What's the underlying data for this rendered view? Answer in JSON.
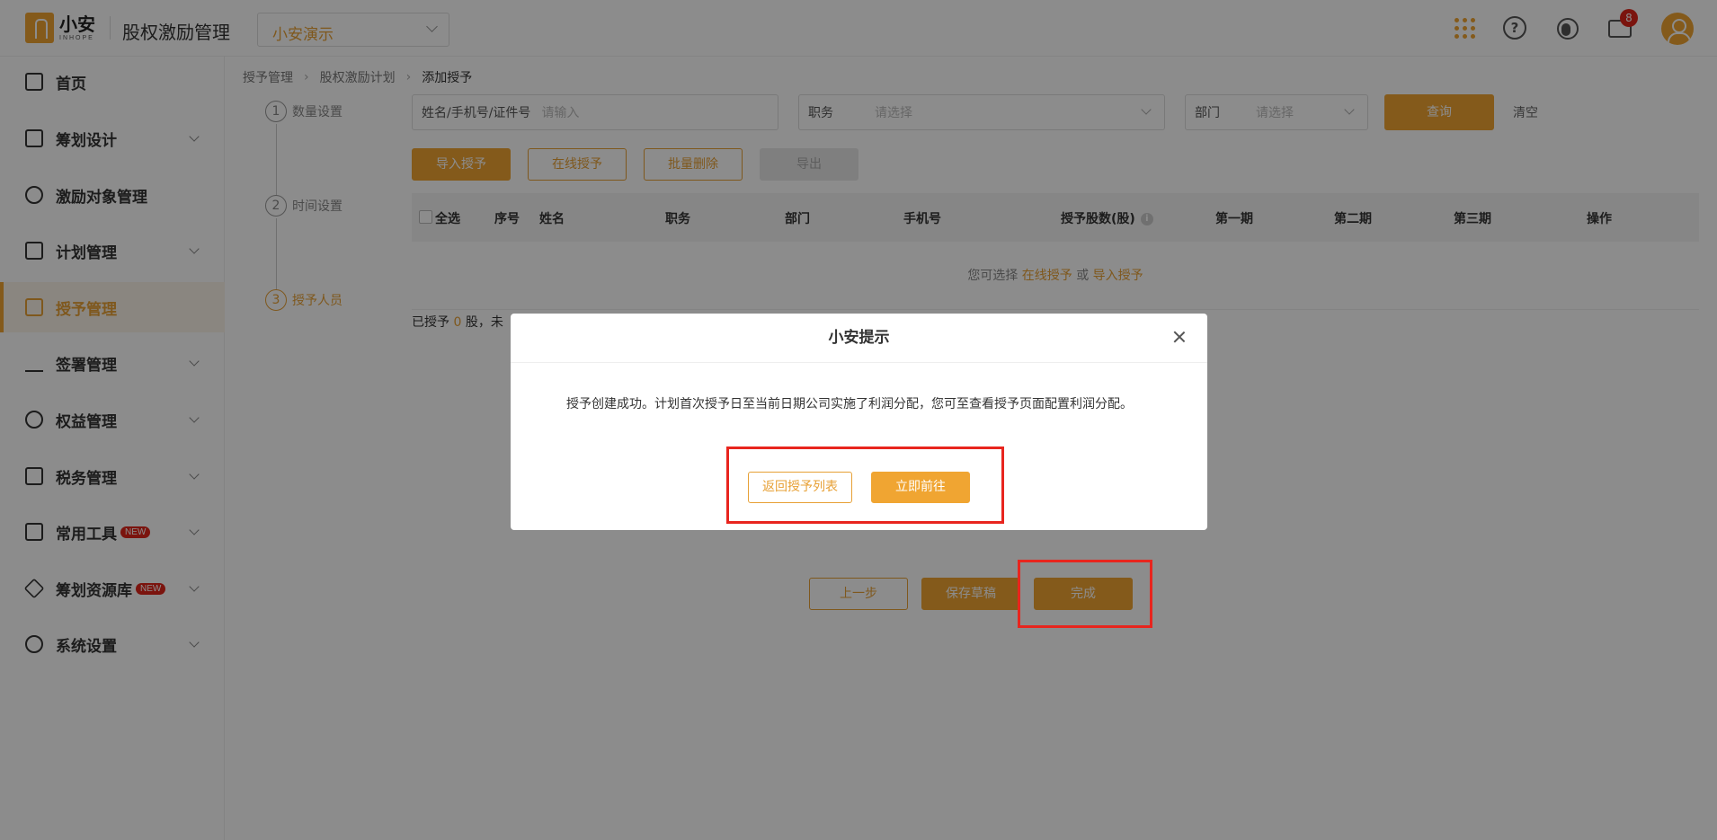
{
  "header": {
    "brand_cn": "小安",
    "brand_en": "INHOPE",
    "app_title": "股权激励管理",
    "company": "小安演示",
    "notification_count": "8",
    "icons": [
      "apps-grid-icon",
      "help-icon",
      "customer-service-icon",
      "message-icon",
      "user-avatar"
    ]
  },
  "sidebar": {
    "items": [
      {
        "label": "首页",
        "icon": "home-icon",
        "has_children": false,
        "active": false,
        "new": false
      },
      {
        "label": "筹划设计",
        "icon": "edit-icon",
        "has_children": true,
        "active": false,
        "new": false
      },
      {
        "label": "激励对象管理",
        "icon": "users-icon",
        "has_children": false,
        "active": false,
        "new": false
      },
      {
        "label": "计划管理",
        "icon": "grid-icon",
        "has_children": true,
        "active": false,
        "new": false
      },
      {
        "label": "授予管理",
        "icon": "document-icon",
        "has_children": false,
        "active": true,
        "new": false
      },
      {
        "label": "签署管理",
        "icon": "sign-icon",
        "has_children": true,
        "active": false,
        "new": false
      },
      {
        "label": "权益管理",
        "icon": "equity-icon",
        "has_children": true,
        "active": false,
        "new": false
      },
      {
        "label": "税务管理",
        "icon": "tax-icon",
        "has_children": true,
        "active": false,
        "new": false
      },
      {
        "label": "常用工具",
        "icon": "toolbox-icon",
        "has_children": true,
        "active": false,
        "new": true
      },
      {
        "label": "筹划资源库",
        "icon": "layers-icon",
        "has_children": true,
        "active": false,
        "new": true
      },
      {
        "label": "系统设置",
        "icon": "settings-icon",
        "has_children": true,
        "active": false,
        "new": false
      }
    ],
    "new_tag": "NEW"
  },
  "breadcrumb": [
    "授予管理",
    "股权激励计划",
    "添加授予"
  ],
  "steps": [
    {
      "num": "1",
      "label": "数量设置"
    },
    {
      "num": "2",
      "label": "时间设置"
    },
    {
      "num": "3",
      "label": "授予人员"
    }
  ],
  "filters": {
    "search_label": "姓名/手机号/证件号",
    "search_placeholder": "请输入",
    "position_label": "职务",
    "position_placeholder": "请选择",
    "dept_label": "部门",
    "dept_placeholder": "请选择",
    "query_button": "查询",
    "clear_link": "清空"
  },
  "actions": {
    "import": "导入授予",
    "online": "在线授予",
    "batch_delete": "批量删除",
    "export": "导出"
  },
  "table": {
    "select_all": "全选",
    "columns": [
      "序号",
      "姓名",
      "职务",
      "部门",
      "手机号",
      "授予股数(股)",
      "第一期",
      "第二期",
      "第三期",
      "操作"
    ],
    "empty_prefix": "您可选择",
    "empty_online": "在线授予",
    "empty_or": "或",
    "empty_import": "导入授予"
  },
  "summary": {
    "prefix": "已授予",
    "count": "0",
    "suffix": "股，未"
  },
  "footer_buttons": {
    "prev": "上一步",
    "save_draft": "保存草稿",
    "finish": "完成"
  },
  "modal": {
    "title": "小安提示",
    "message": "授予创建成功。计划首次授予日至当前日期公司实施了利润分配，您可至查看授予页面配置利润分配。",
    "back_button": "返回授予列表",
    "go_button": "立即前往"
  }
}
